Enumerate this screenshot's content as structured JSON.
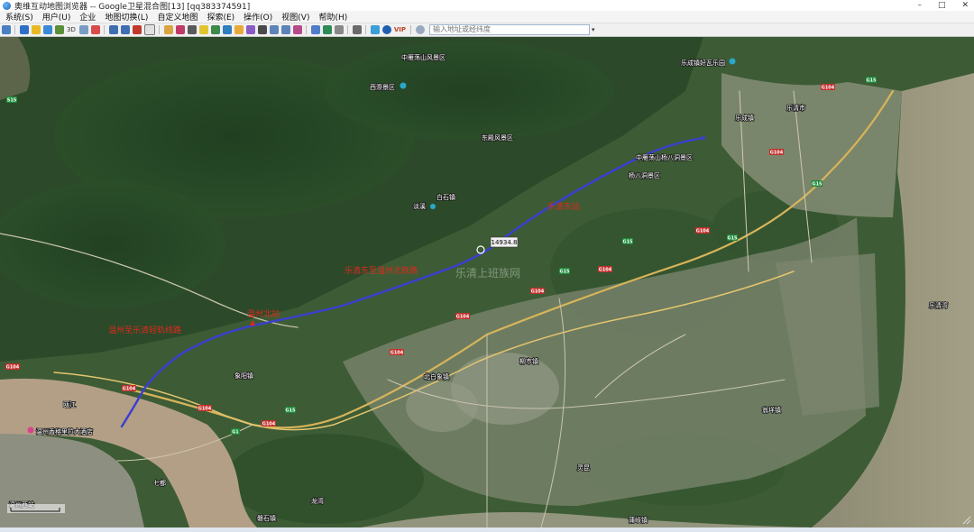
{
  "window": {
    "title": "奥维互动地图浏览器 -- Google卫星混合图[13] [qq383374591]",
    "controls": {
      "minimize": "–",
      "maximize": "□",
      "close": "✕"
    }
  },
  "menu": [
    "系统(S)",
    "用户(U)",
    "企业",
    "地图切换(L)",
    "自定义地图",
    "探索(E)",
    "操作(O)",
    "视图(V)",
    "帮助(H)"
  ],
  "toolbar": {
    "label_3d": "3D",
    "label_vip": "VIP",
    "search_placeholder": "输入地址或经纬度"
  },
  "colors": {
    "route": "#3a3fd0",
    "annotation_red": "#e1281d",
    "road_highway": "#d8b45a",
    "shield_red": "#c0302c",
    "shield_green": "#1d8a3a"
  },
  "map": {
    "route_badge": "14934.8",
    "annotations": [
      "乐清东站",
      "乐清东至温州北铁路",
      "温州北站",
      "温州至乐清轻轨线路"
    ],
    "watermark": "乐清上班族网",
    "place_labels": [
      "中雁荡山风景区",
      "西漈景区",
      "乐成镇好瓦乐园",
      "乐清市",
      "乐成镇",
      "东殿风景区",
      "中雁荡山杨八洞景区",
      "杨八洞景区",
      "白石镇",
      "淡溪",
      "柳市镇",
      "北白象镇",
      "瓯江",
      "温州香格里拉大酒店",
      "七都",
      "磐石镇",
      "蒲岐镇",
      "翁垟镇",
      "温州西站",
      "象阳镇",
      "乐清湾",
      "灵昆",
      "龙湾"
    ],
    "shields": [
      "G104",
      "G104",
      "G104",
      "G104",
      "G104",
      "G104",
      "G104",
      "G104",
      "G104",
      "G104",
      "G15",
      "G15",
      "G15",
      "G15",
      "G15",
      "S15",
      "G15",
      "G1",
      "G104"
    ]
  }
}
